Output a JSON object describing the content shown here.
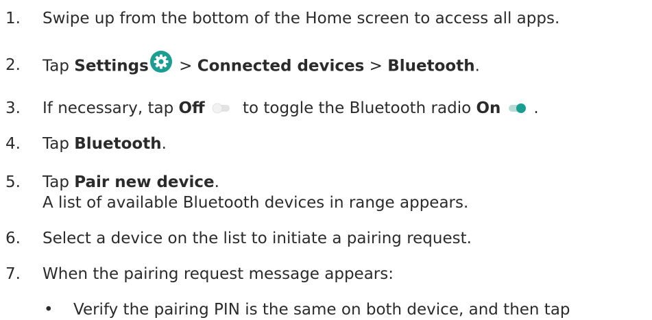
{
  "steps": [
    {
      "number": "1.",
      "parts": [
        "Swipe up from the bottom of the Home screen to access all apps."
      ]
    },
    {
      "number": "2.",
      "parts": [
        "Tap ",
        "Settings",
        " ",
        " > ",
        "Connected devices",
        " > ",
        "Bluetooth",
        "."
      ]
    },
    {
      "number": "3.",
      "parts": [
        "If necessary, tap ",
        "Off",
        " to toggle the Bluetooth radio ",
        "On",
        "."
      ]
    },
    {
      "number": "4.",
      "parts": [
        "Tap ",
        "Bluetooth",
        "."
      ]
    },
    {
      "number": "5.",
      "parts": [
        "Tap ",
        "Pair new device",
        "."
      ],
      "continuation": "A list of available Bluetooth devices in range appears."
    },
    {
      "number": "6.",
      "parts": [
        "Select a device on the list to initiate a pairing request."
      ]
    },
    {
      "number": "7.",
      "parts": [
        "When the pairing request message appears:"
      ]
    }
  ],
  "bullet": {
    "symbol": "•",
    "text": "Verify the pairing PIN is the same on both device, and then tap"
  },
  "icons": {
    "settings": "gear-icon",
    "toggle_off": "toggle-off-icon",
    "toggle_on": "toggle-on-icon"
  },
  "colors": {
    "accent": "#1a9e91",
    "text": "#2b2b2b",
    "toggle_off_track": "#e3e3e3",
    "toggle_off_knob": "#f2f2f2",
    "toggle_on_track": "#b7dcd7"
  }
}
